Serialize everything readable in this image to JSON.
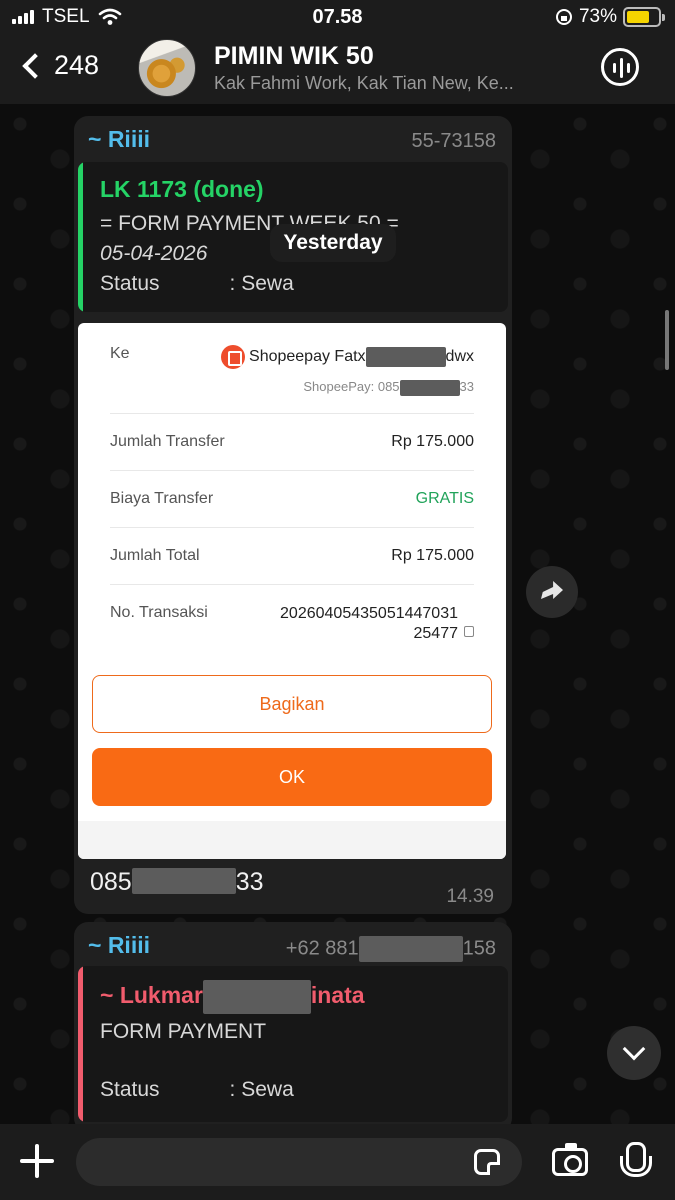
{
  "status_bar": {
    "carrier": "TSEL",
    "time": "07.58",
    "battery": "73%",
    "battery_level": 0.73
  },
  "header": {
    "back_count": "248",
    "title": "PIMIN WIK 50",
    "subtitle": "Kak Fahmi Work, Kak Tian New, Ke..."
  },
  "date_separator": "Yesterday",
  "message1": {
    "sender": "~ Riiii",
    "phone_tail": "55-73158",
    "quote": {
      "line1": "LK 1173 (done)",
      "line2": "= FORM PAYMENT WEEK 50 =",
      "line3": "05-04-2026",
      "line4": "Status            : Sewa"
    },
    "receipt": {
      "to_label": "Ke",
      "to_name_prefix": "Shopeepay Fatx",
      "to_name_suffix": "dwx",
      "to_account_prefix": "ShopeePay: 085",
      "to_account_suffix": "33",
      "amount_label": "Jumlah Transfer",
      "amount_value": "Rp 175.000",
      "fee_label": "Biaya Transfer",
      "fee_value": "GRATIS",
      "total_label": "Jumlah Total",
      "total_value": "Rp 175.000",
      "txn_label": "No. Transaksi",
      "txn_value_line1": "20260405435051447031",
      "txn_value_line2": "25477",
      "share_button": "Bagikan",
      "ok_button": "OK"
    },
    "caption_prefix": "085",
    "caption_suffix": "33",
    "time": "14.39"
  },
  "message2": {
    "sender": "~ Riiii",
    "phone_prefix": "+62 881",
    "phone_suffix": "158",
    "quote": {
      "name_prefix": "~ Lukmar",
      "name_suffix": "inata",
      "line2": "FORM PAYMENT",
      "line3": "Status            : Sewa"
    }
  },
  "colors": {
    "accent_green": "#25d366",
    "accent_red": "#f15c6d",
    "sender_blue": "#53bdeb",
    "shopee_orange": "#f96a14",
    "gratis_green": "#21a35a"
  },
  "icons": [
    "back-chevron-icon",
    "voice-chat-icon",
    "forward-icon",
    "scroll-down-icon",
    "plus-icon",
    "sticker-icon",
    "camera-icon",
    "mic-icon",
    "shopeepay-icon",
    "copy-icon"
  ]
}
